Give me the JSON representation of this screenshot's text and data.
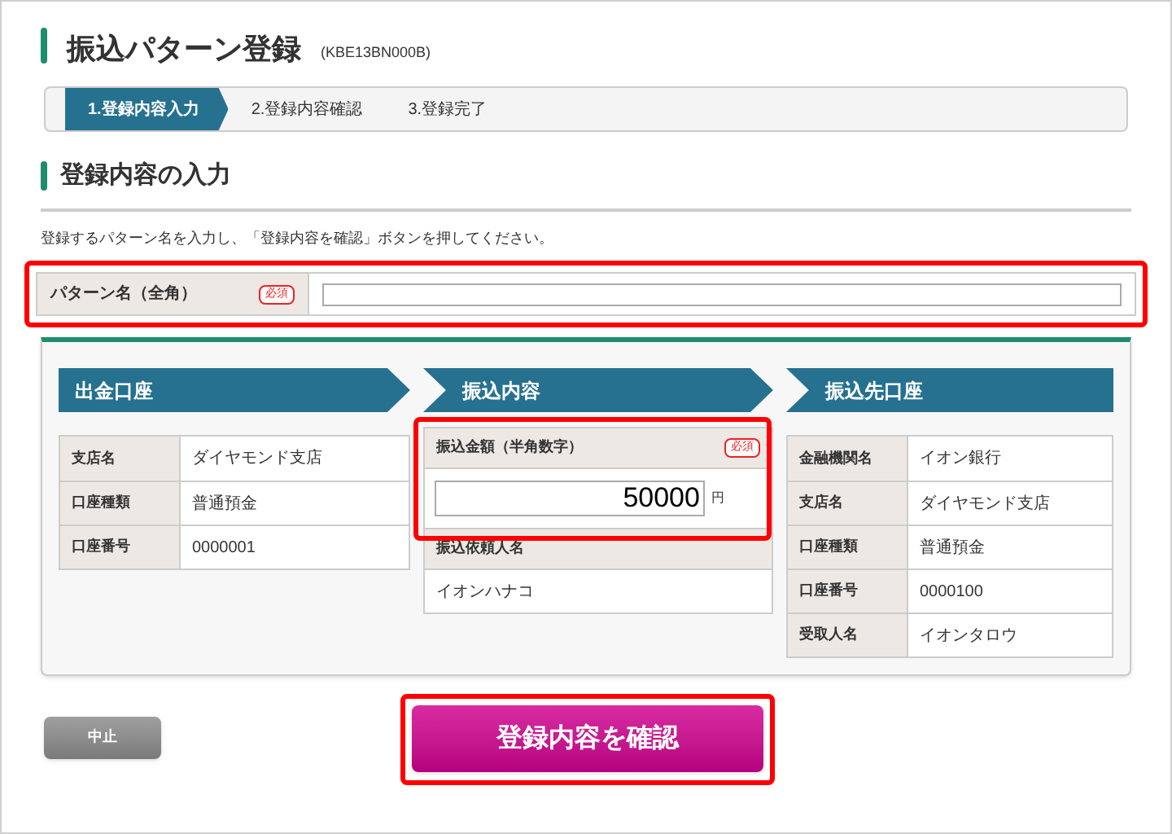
{
  "page_title": "振込パターン登録",
  "screen_code": "(KBE13BN000B)",
  "steps": [
    {
      "label": "1.登録内容入力",
      "selected": true
    },
    {
      "label": "2.登録内容確認",
      "selected": false
    },
    {
      "label": "3.登録完了",
      "selected": false
    }
  ],
  "section_title": "登録内容の入力",
  "instruction": "登録するパターン名を入力し、「登録内容を確認」ボタンを押してください。",
  "pattern_name": {
    "label": "パターン名（全角）",
    "required_badge": "必須"
  },
  "columns": [
    {
      "title": "出金口座",
      "rows": [
        {
          "label": "支店名",
          "value": "ダイヤモンド支店"
        },
        {
          "label": "口座種類",
          "value": "普通預金"
        },
        {
          "label": "口座番号",
          "value": "0000001"
        }
      ]
    },
    {
      "title": "振込内容",
      "amount": {
        "label": "振込金額（半角数字）",
        "required_badge": "必須",
        "value": "50000",
        "unit": "円"
      },
      "requester": {
        "label": "振込依頼人名",
        "value": "イオンハナコ"
      }
    },
    {
      "title": "振込先口座",
      "rows": [
        {
          "label": "金融機関名",
          "value": "イオン銀行"
        },
        {
          "label": "支店名",
          "value": "ダイヤモンド支店"
        },
        {
          "label": "口座種類",
          "value": "普通預金"
        },
        {
          "label": "口座番号",
          "value": "0000100"
        },
        {
          "label": "受取人名",
          "value": "イオンタロウ"
        }
      ]
    }
  ],
  "buttons": {
    "cancel": "中止",
    "confirm": "登録内容を確認"
  }
}
